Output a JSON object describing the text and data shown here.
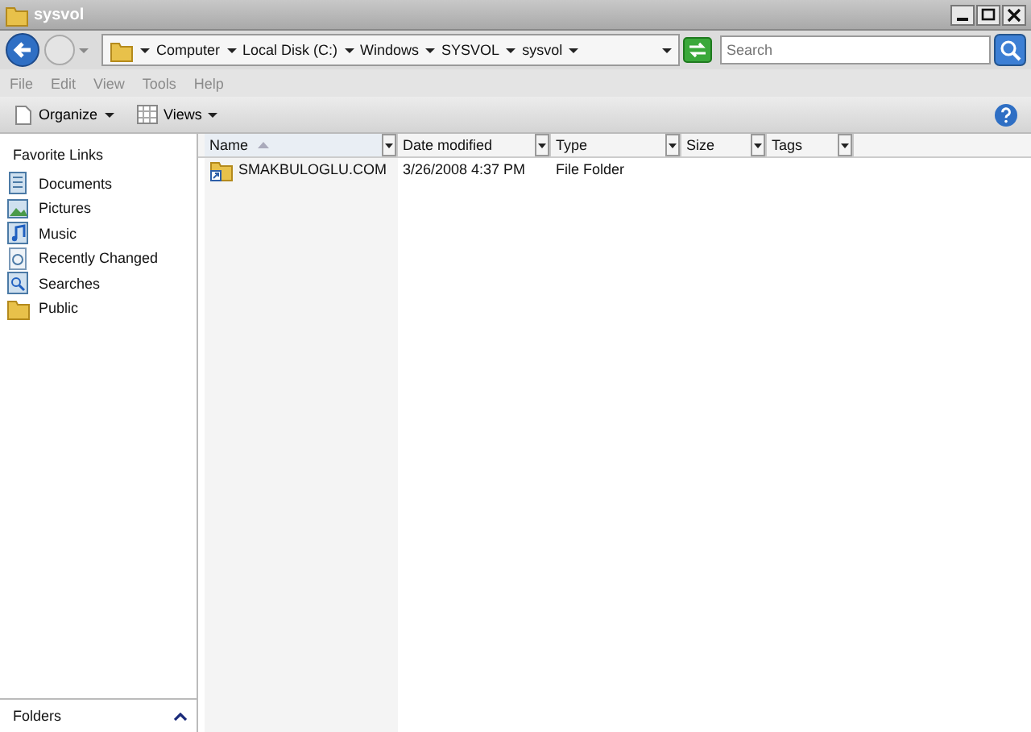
{
  "window": {
    "title": "sysvol"
  },
  "address_bar": {
    "segments": [
      "Computer",
      "Local Disk (C:)",
      "Windows",
      "SYSVOL",
      "sysvol"
    ]
  },
  "search": {
    "placeholder": "Search"
  },
  "menu": [
    {
      "label": "File"
    },
    {
      "label": "Edit"
    },
    {
      "label": "View"
    },
    {
      "label": "Tools"
    },
    {
      "label": "Help"
    }
  ],
  "toolbar": [
    {
      "label": "Organize",
      "kind": "organize"
    },
    {
      "label": "Views",
      "kind": "views"
    }
  ],
  "sidebar": {
    "title": "Favorite Links",
    "items": [
      {
        "label": "Documents",
        "kind": "documents"
      },
      {
        "label": "Pictures",
        "kind": "pictures"
      },
      {
        "label": "Music",
        "kind": "music"
      },
      {
        "label": "Recently Changed",
        "kind": "recent"
      },
      {
        "label": "Searches",
        "kind": "searches"
      },
      {
        "label": "Public",
        "kind": "folder"
      }
    ]
  },
  "table": {
    "columns": [
      {
        "label": "Name",
        "sorted": true
      },
      {
        "label": "Date modified",
        "sorted": false
      },
      {
        "label": "Type",
        "sorted": false
      },
      {
        "label": "Size",
        "sorted": false
      },
      {
        "label": "Tags",
        "sorted": false
      }
    ],
    "rows": [
      {
        "cells": [
          "SMAKBULOGLU.COM",
          "3/26/2008 4:37 PM",
          "File Folder"
        ]
      }
    ]
  },
  "folders_bar": {
    "label": "Folders"
  }
}
